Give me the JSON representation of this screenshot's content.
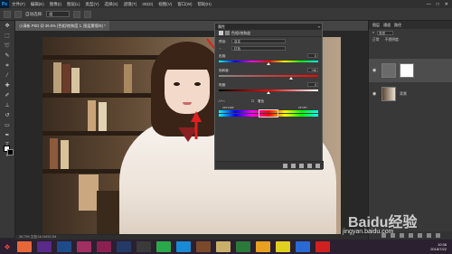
{
  "app": {
    "logo": "Ps"
  },
  "menubar": {
    "items": [
      "文件(F)",
      "编辑(E)",
      "图像(I)",
      "图层(L)",
      "类型(Y)",
      "选择(S)",
      "滤镜(T)",
      "3D(D)",
      "视图(V)",
      "窗口(W)",
      "帮助(H)"
    ]
  },
  "options_bar": {
    "label": "自动选择:",
    "select_value": "组"
  },
  "document": {
    "tab_title": "小清新.PSD @ 36.6% (色相/饱和度 1, 图层蒙版/8) *",
    "status_text": "36.73%   文档:16.1M/32.2M"
  },
  "hue_dialog": {
    "title": "属性",
    "header_label": "色相/饱和度",
    "preset_label": "预设:",
    "preset_value": "自定",
    "channel_value": "红色",
    "hue_label": "色相:",
    "hue_value": "0",
    "saturation_label": "饱和度:",
    "saturation_value": "+46",
    "lightness_label": "明度:",
    "lightness_value": "0",
    "colorize_label": "着色",
    "range_left": "315°/345°",
    "range_right": "15°/45°",
    "values": {
      "hue": 0,
      "saturation": 46,
      "lightness": 0
    }
  },
  "right_panel": {
    "tabs": [
      "图层",
      "通道",
      "路径"
    ],
    "filter_label": "类型",
    "mode_label": "正常",
    "opacity_label": "不透明度:",
    "layers": [
      {
        "name": "色相/饱和度 1",
        "visible": true,
        "selected": true
      },
      {
        "name": "背景",
        "visible": true,
        "selected": false
      }
    ]
  },
  "taskbar": {
    "time": "10:38",
    "date": "2018/7/22"
  },
  "watermark": {
    "line1": "Baidu经验",
    "line2": "jingyan.baidu.com"
  },
  "colors": {
    "accent_red": "#e02020",
    "ps_blue": "#31a8ff"
  }
}
